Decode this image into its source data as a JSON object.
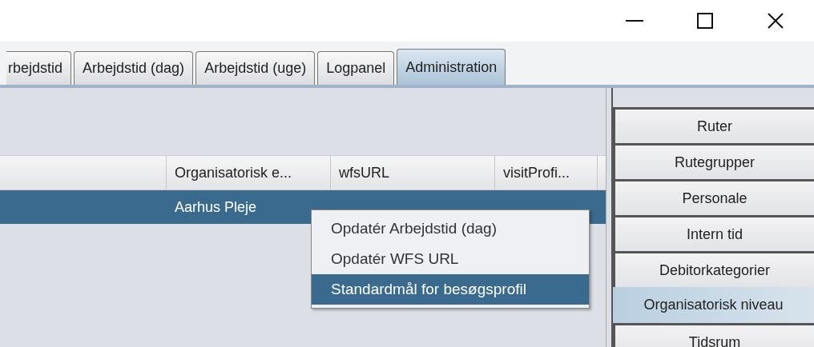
{
  "window": {
    "controls": [
      {
        "kind": "minimize"
      },
      {
        "kind": "maximize"
      },
      {
        "kind": "close"
      }
    ]
  },
  "tabs": [
    {
      "label": "rbejdstid",
      "selected": false
    },
    {
      "label": "Arbejdstid (dag)",
      "selected": false
    },
    {
      "label": "Arbejdstid (uge)",
      "selected": false
    },
    {
      "label": "Logpanel",
      "selected": false
    },
    {
      "label": "Administration",
      "selected": true
    }
  ],
  "table": {
    "columns": [
      "",
      "Organisatorisk e...",
      "wfsURL",
      "visitProfi..."
    ],
    "rows": [
      {
        "cells": [
          "",
          "Aarhus Pleje",
          "",
          ""
        ],
        "selected": true
      }
    ]
  },
  "context_menu": {
    "items": [
      {
        "label": "Opdatér Arbejdstid (dag)",
        "selected": false
      },
      {
        "label": "Opdatér WFS URL",
        "selected": false
      },
      {
        "label": "Standardmål for besøgsprofil",
        "selected": true
      }
    ]
  },
  "sidebar": {
    "items": [
      {
        "label": "Ruter",
        "selected": false
      },
      {
        "label": "Rutegrupper",
        "selected": false
      },
      {
        "label": "Personale",
        "selected": false
      },
      {
        "label": "Intern tid",
        "selected": false
      },
      {
        "label": "Debitorkategorier",
        "selected": false
      },
      {
        "label": "Organisatorisk niveau",
        "selected": true
      },
      {
        "label": "Tidsrum",
        "selected": false
      }
    ]
  }
}
